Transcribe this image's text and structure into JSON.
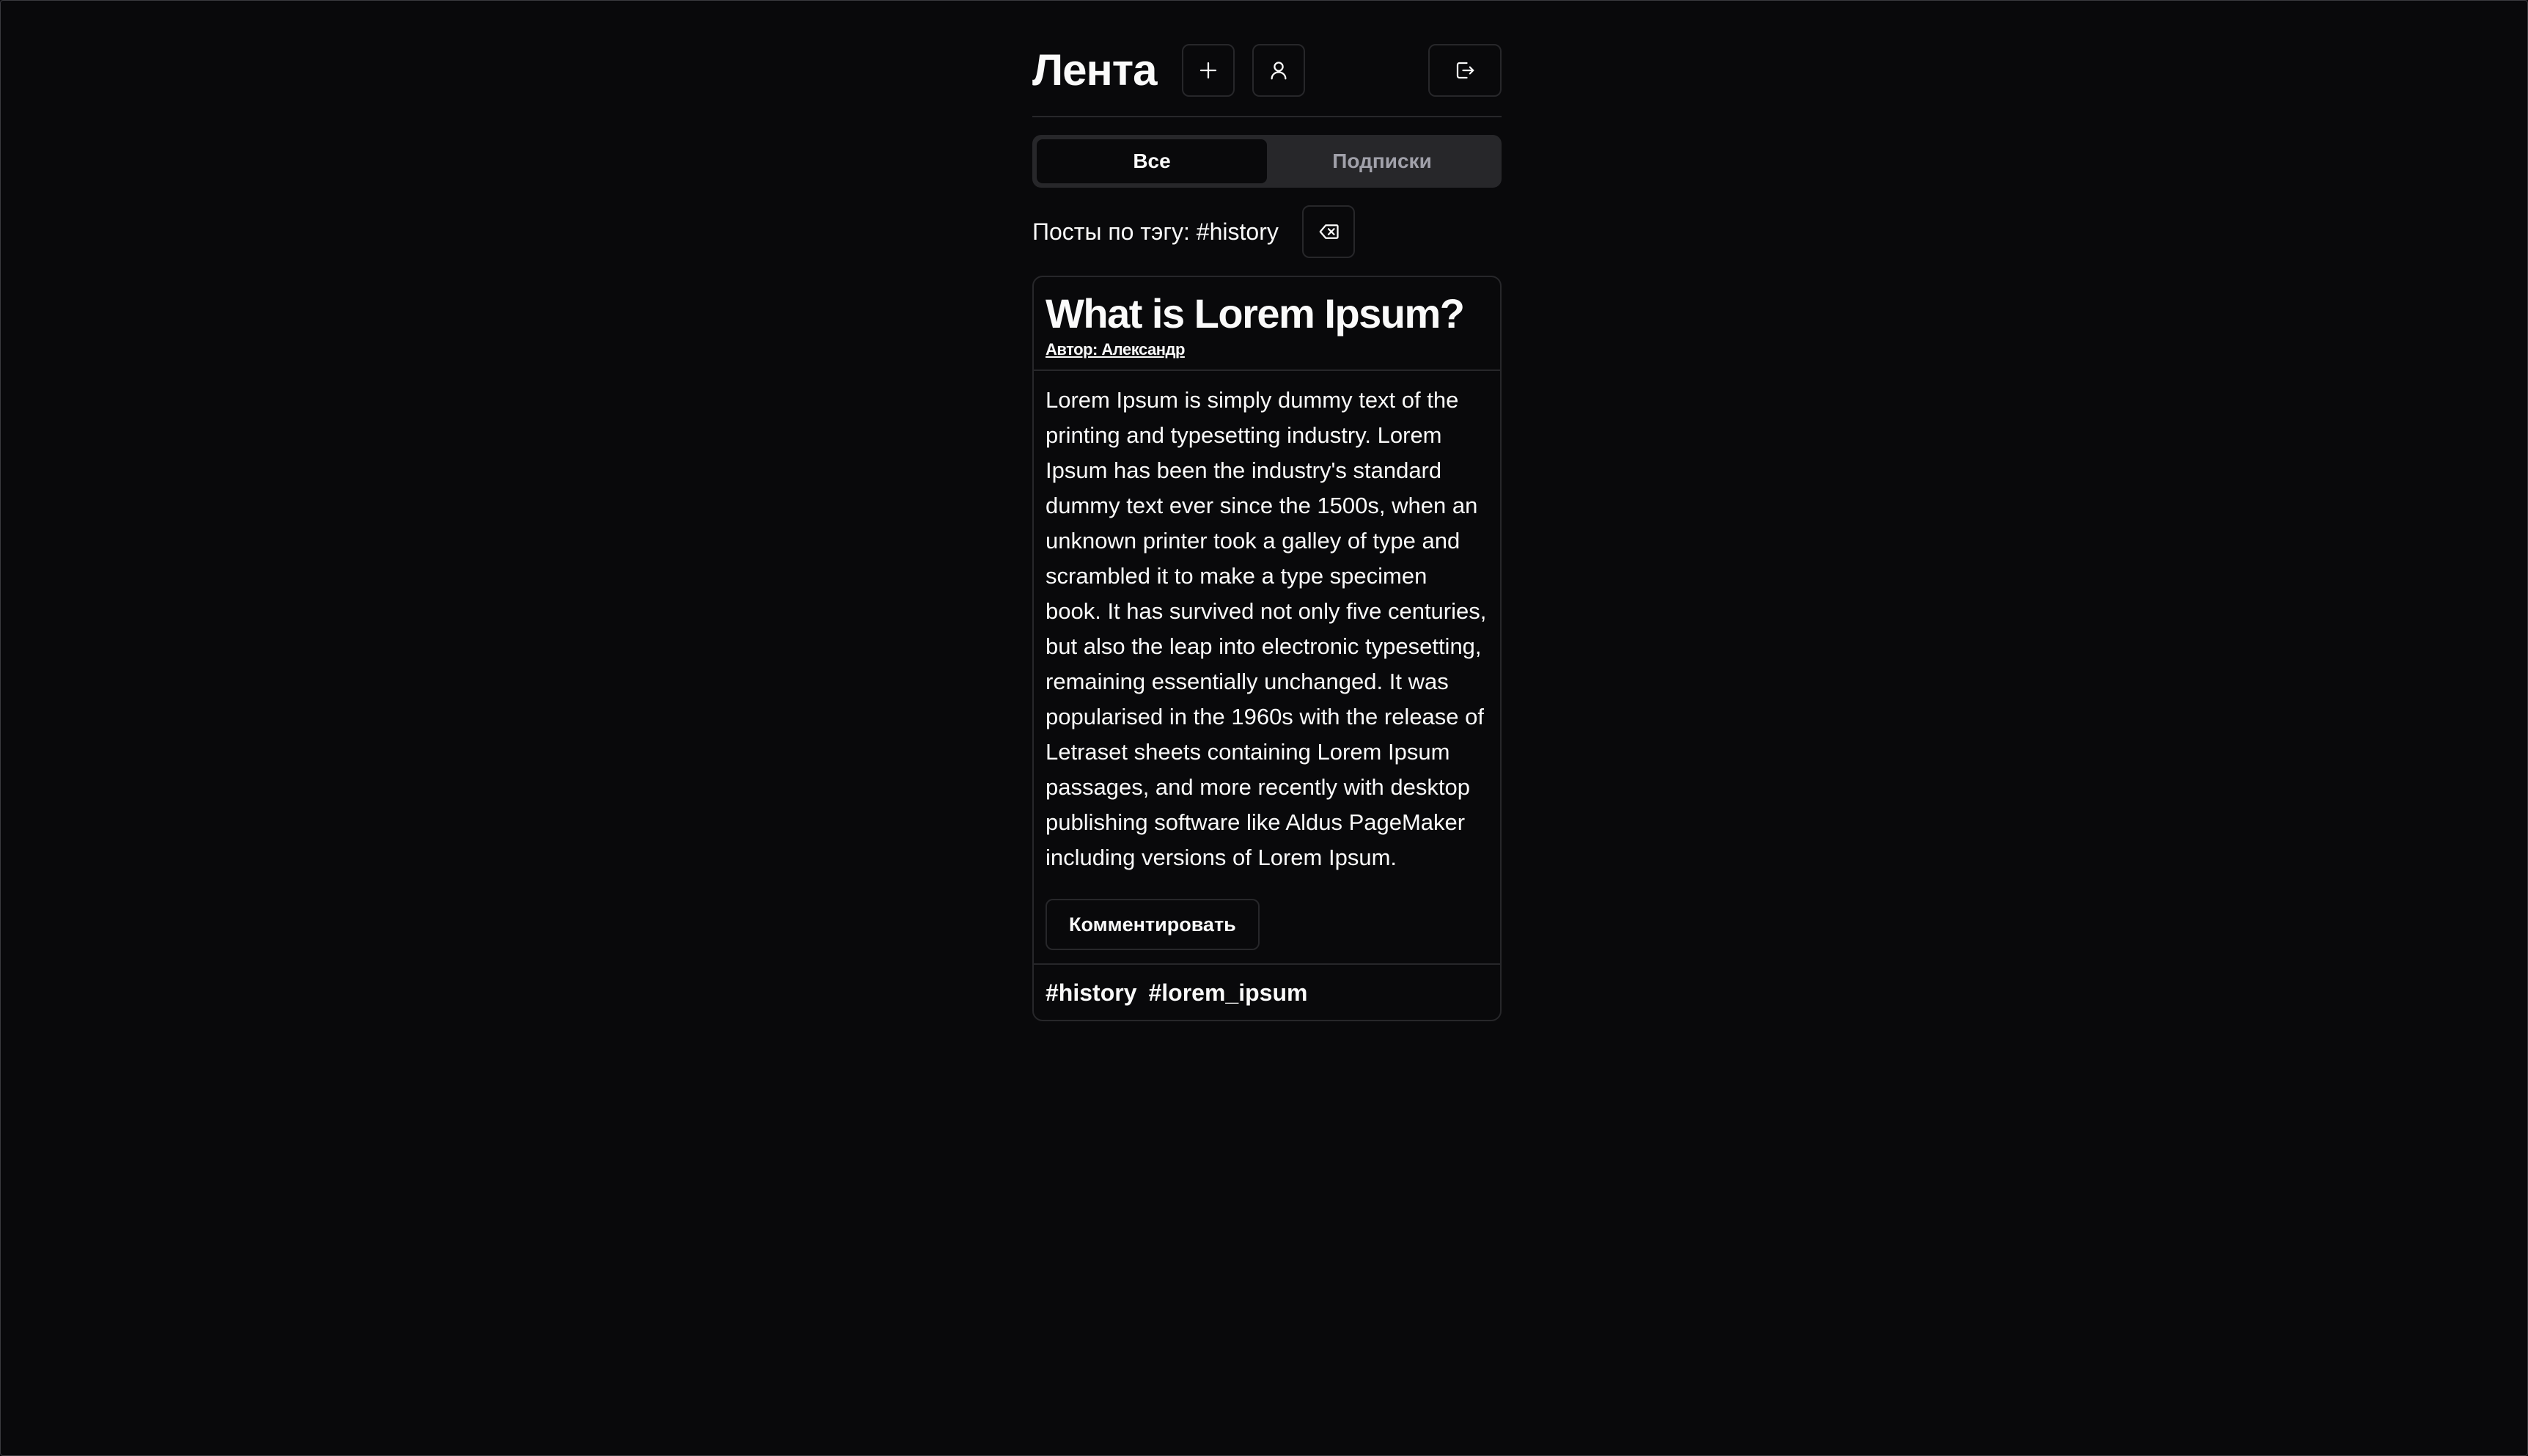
{
  "header": {
    "title": "Лента",
    "add_icon": "plus-icon",
    "profile_icon": "user-icon",
    "logout_icon": "log-out-icon"
  },
  "tabs": [
    {
      "label": "Все",
      "active": true
    },
    {
      "label": "Подписки",
      "active": false
    }
  ],
  "tag_filter": {
    "label": "Посты по тэгу: #history",
    "clear_icon": "backspace-icon"
  },
  "posts": [
    {
      "title": "What is Lorem Ipsum?",
      "author": "Автор: Александр",
      "body": "Lorem Ipsum is simply dummy text of the printing and typesetting industry. Lorem Ipsum has been the industry's standard dummy text ever since the 1500s, when an unknown printer took a galley of type and scrambled it to make a type specimen book. It has survived not only five centuries, but also the leap into electronic typesetting, remaining essentially unchanged. It was popularised in the 1960s with the release of Letraset sheets containing Lorem Ipsum passages, and more recently with desktop publishing software like Aldus PageMaker including versions of Lorem Ipsum.",
      "comment_label": "Комментировать",
      "tags": [
        "#history",
        "#lorem_ipsum"
      ]
    }
  ],
  "colors": {
    "background": "#09090b",
    "border": "#27272a",
    "text": "#fafafa",
    "muted": "#a1a1aa"
  }
}
